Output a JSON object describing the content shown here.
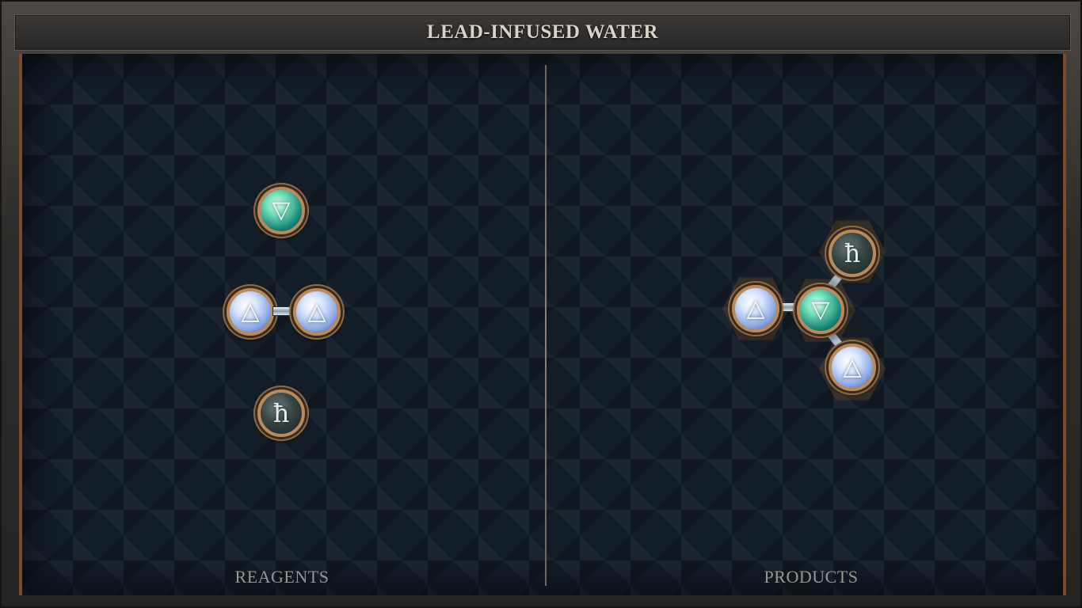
{
  "title": "LEAD-INFUSED WATER",
  "panels": {
    "reagents_label": "REAGENTS",
    "products_label": "PRODUCTS"
  },
  "glyphs": {
    "water": "▽",
    "air": "△",
    "lead": "ħ"
  },
  "reagents": [
    {
      "molecule": "water",
      "atoms": [
        "water"
      ]
    },
    {
      "molecule": "air-pair",
      "atoms": [
        "air",
        "air"
      ],
      "bonds": 1
    },
    {
      "molecule": "lead",
      "atoms": [
        "lead"
      ]
    }
  ],
  "products": [
    {
      "molecule": "lead-infused-water",
      "atoms": [
        "air",
        "water",
        "lead",
        "air"
      ],
      "bonds": 3
    }
  ],
  "colors": {
    "water": "#4fd3a6",
    "air": "#c9dcff",
    "lead": "#3a4848",
    "frame_copper": "#b98a5c",
    "board_bg": "#121d27"
  }
}
